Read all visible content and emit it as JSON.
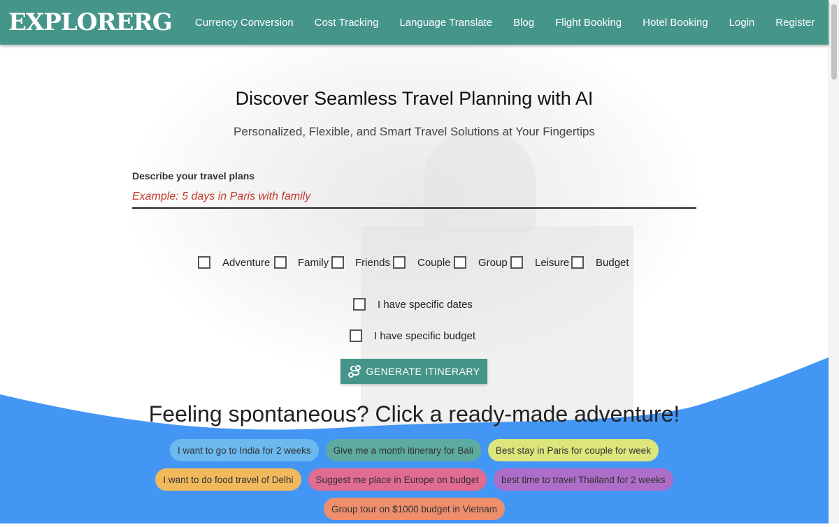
{
  "nav": {
    "logo": "EXPLORERG",
    "links": [
      "Currency Conversion",
      "Cost Tracking",
      "Language Translate",
      "Blog",
      "Flight Booking",
      "Hotel Booking",
      "Login",
      "Register"
    ]
  },
  "hero": {
    "title": "Discover Seamless Travel Planning with AI",
    "subtitle": "Personalized, Flexible, and Smart Travel Solutions at Your Fingertips"
  },
  "form": {
    "label": "Describe your travel plans",
    "placeholder": "Example: 5 days in Paris with family",
    "categories": [
      "Adventure",
      "Family",
      "Friends",
      "Couple",
      "Group",
      "Leisure",
      "Budget"
    ],
    "dates_label": "I have specific dates",
    "budget_label": "I have specific budget",
    "generate_label": "GENERATE ITINERARY",
    "generate_icon": "route-icon"
  },
  "spontaneous": {
    "title": "Feeling spontaneous? Click a ready-made adventure!",
    "chips": [
      {
        "label": "I want to go to India for 2 weeks",
        "color": "#6cb9f0"
      },
      {
        "label": "Give me a month itinerary for Bali",
        "color": "#5dab9e"
      },
      {
        "label": "Best stay in Paris for couple for week",
        "color": "#dde67b"
      },
      {
        "label": "I want to do food travel of Delhi",
        "color": "#f1b95c"
      },
      {
        "label": "Suggest me place in Europe on budget",
        "color": "#e26b91"
      },
      {
        "label": "best time to travel Thailand for 2 weeks",
        "color": "#ad6dc8"
      },
      {
        "label": "Group tour on $1000 budget in Vietnam",
        "color": "#ef8e6c"
      }
    ]
  },
  "colors": {
    "brand": "#45958a",
    "wave": "#4496f5"
  }
}
